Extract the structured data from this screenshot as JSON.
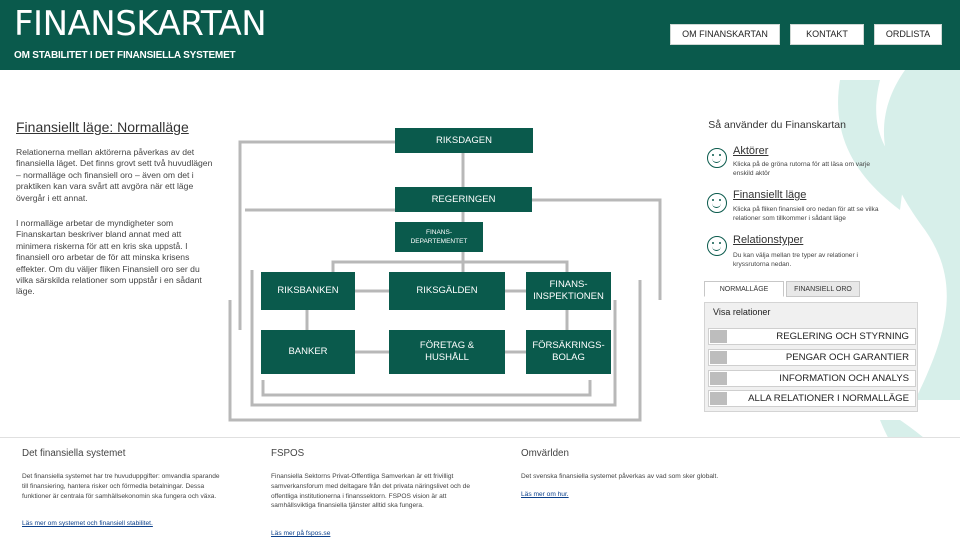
{
  "header": {
    "title": "FINANSKARTAN",
    "subtitle": "OM STABILITET I DET FINANSIELLA SYSTEMET",
    "nav": [
      {
        "label": "OM FINANSKARTAN"
      },
      {
        "label": "KONTAKT"
      },
      {
        "label": "ORDLISTA"
      }
    ],
    "color": "#0a5a4c"
  },
  "intro": {
    "heading": "Finansiellt läge: Normalläge",
    "p1": "Relationerna mellan aktörerna påverkas av det finansiella läget. Det finns grovt sett två huvudlägen – normalläge och finansiell oro – även om det i praktiken kan vara svårt att avgöra när ett läge övergår i ett annat.",
    "p2": "I normalläge arbetar de myndigheter som Finanskartan beskriver bland annat med att minimera riskerna för att en kris ska uppstå. I finansiell oro arbetar de för att minska krisens effekter. Om du väljer fliken Finansiell oro ser du vilka särskilda relationer som uppstår i en sådant läge."
  },
  "diagram": {
    "riksdagen": "RIKSDAGEN",
    "regeringen": "REGERINGEN",
    "finansdep_1": "FINANS-",
    "finansdep_2": "DEPARTEMENTET",
    "riksbanken": "RIKSBANKEN",
    "riksgalden": "RIKSGÄLDEN",
    "fi_1": "FINANS-",
    "fi_2": "INSPEKTIONEN",
    "banker": "BANKER",
    "foretag_1": "FÖRETAG &",
    "foretag_2": "HUSHÅLL",
    "forsakring_1": "FÖRSÄKRINGS-",
    "forsakring_2": "BOLAG"
  },
  "help": {
    "heading": "Så använder du Finanskartan",
    "items": [
      {
        "title": "Aktörer",
        "desc": "Klicka på de gröna rutorna för att läsa om varje enskild aktör",
        "icon": "smiley-icon"
      },
      {
        "title": "Finansiellt läge",
        "desc": "Klicka på fliken finansiell oro nedan för att se vilka relationer som tillkommer i sådant läge",
        "icon": "smiley-icon"
      },
      {
        "title": "Relationstyper",
        "desc": "Du kan välja mellan tre typer av relationer i kryssrutorna nedan.",
        "icon": "smiley-icon"
      }
    ]
  },
  "tabs": [
    {
      "label": "NORMALLÄGE",
      "active": true
    },
    {
      "label": "FINANSIELL ORO",
      "active": false
    }
  ],
  "relations": {
    "title": "Visa relationer",
    "options": [
      {
        "label": "REGLERING OCH STYRNING"
      },
      {
        "label": "PENGAR OCH GARANTIER"
      },
      {
        "label": "INFORMATION OCH ANALYS"
      },
      {
        "label": "ALLA RELATIONER I NORMALLÄGE"
      }
    ]
  },
  "footer": {
    "col1": {
      "heading": "Det finansiella systemet",
      "text": "Det finansiella systemet har tre huvuduppgifter: omvandla sparande till finansiering, hantera risker och förmedla betalningar. Dessa funktioner är centrala för samhällsekonomin ska fungera och växa.",
      "link": "Läs mer om systemet och finansiell stabilitet."
    },
    "col2": {
      "heading": "FSPOS",
      "text": "Finansiella Sektorns Privat-Offentliga Samverkan är ett frivilligt samverkansforum med deltagare från det privata näringslivet och de offentliga institutionerna i finanssektorn. FSPOS vision är att samhällsviktiga finansiella tjänster alltid ska fungera.",
      "link": "Läs mer på fspos.se"
    },
    "col3": {
      "heading": "Omvärlden",
      "text": "Det svenska finansiella systemet påverkas av vad som sker globalt.",
      "link": "Läs mer om hur."
    }
  }
}
